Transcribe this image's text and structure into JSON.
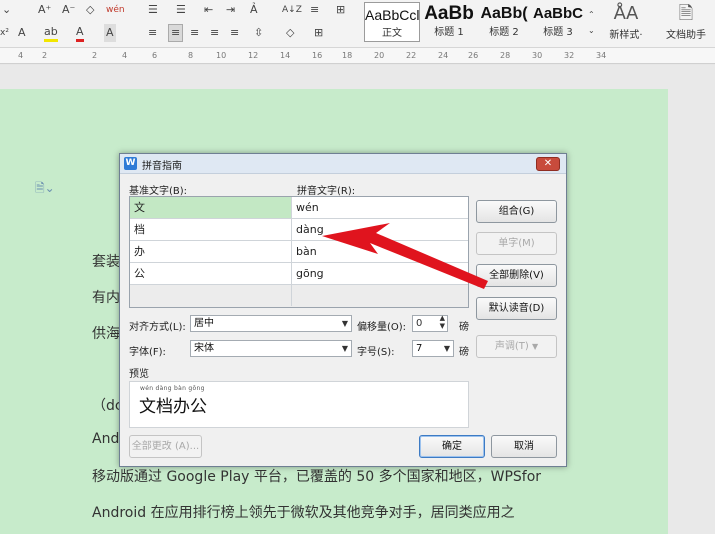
{
  "ribbon": {
    "font_row": {
      "grow_font": "A⁺",
      "shrink_font": "A⁻",
      "clear_format": "◇",
      "phonetic_guide": "wén",
      "superscript": "x²",
      "text_effect": "A",
      "highlight": "ab",
      "font_color": "A",
      "char_shading": "A"
    },
    "para_row": {
      "bullets": "☰",
      "numbering": "☰",
      "outdent": "⇤",
      "indent": "⇥",
      "sort": "A↓Z",
      "spacing": "≡",
      "borders": "⊞"
    },
    "styles": [
      {
        "sample": "AaBbCcl",
        "name": "正文"
      },
      {
        "sample": "AaBb",
        "name": "标题 1"
      },
      {
        "sample": "AaBb(",
        "name": "标题 2"
      },
      {
        "sample": "AaBbC",
        "name": "标题 3"
      }
    ],
    "new_style": {
      "icon": "ÅA",
      "label": "新样式·"
    },
    "doc_assistant": {
      "label": "文档助手"
    }
  },
  "ruler": {
    "ticks": [
      "4",
      "2",
      "2",
      "4",
      "6",
      "8",
      "10",
      "12",
      "14",
      "16",
      "18",
      "20",
      "22",
      "24",
      "26",
      "28",
      "30",
      "32",
      "34"
    ]
  },
  "document": {
    "lines": [
      "套装",
      "有内",
      "供海",
      "（dc",
      "And",
      "移动版通过 Google Play 平台，已覆盖的 50 多个国家和地区，WPSfor",
      "Android 在应用排行榜上领先于微软及其他竞争对手，居同类应用之"
    ]
  },
  "dialog": {
    "title": "拼音指南",
    "close_icon": "✕",
    "base_text_label": "基准文字(B):",
    "pinyin_text_label": "拼音文字(R):",
    "rows": [
      {
        "base": "文",
        "pinyin": "wén"
      },
      {
        "base": "档",
        "pinyin": "dàng"
      },
      {
        "base": "办",
        "pinyin": "bàn"
      },
      {
        "base": "公",
        "pinyin": "gōng"
      }
    ],
    "buttons": {
      "combine": "组合(G)",
      "single": "单字(M)",
      "delete_all": "全部删除(V)",
      "default_reading": "默认读音(D)",
      "tone": "声调(T)",
      "change_all": "全部更改 (A)...",
      "ok": "确定",
      "cancel": "取消"
    },
    "align_label": "对齐方式(L):",
    "align_value": "居中",
    "offset_label": "偏移量(O):",
    "offset_value": "0",
    "offset_unit": "磅",
    "font_label": "字体(F):",
    "font_value": "宋体",
    "size_label": "字号(S):",
    "size_value": "7",
    "size_unit": "磅",
    "preview_label": "预览",
    "preview_pinyin": "wén dàng bàn gōng",
    "preview_text": "文档办公"
  },
  "colors": {
    "page_background": "#c7ebcb",
    "annotation_arrow": "#e0141e"
  }
}
